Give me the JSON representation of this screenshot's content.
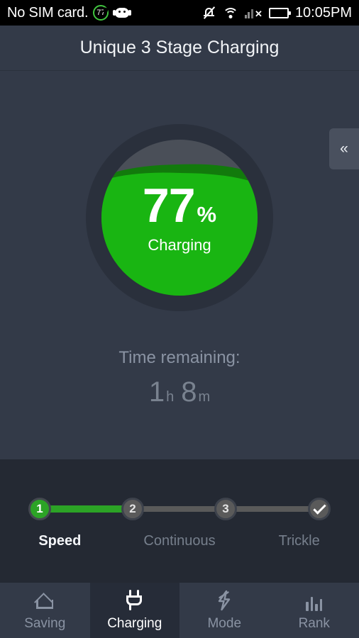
{
  "status_bar": {
    "carrier": "No SIM card.",
    "battery_badge": "77",
    "icons": [
      "battery-circle-icon",
      "android-robot-icon",
      "mute-icon",
      "wifi-icon",
      "signal-no-service-icon",
      "battery-icon"
    ],
    "time": "10:05PM"
  },
  "header": {
    "title": "Unique 3 Stage Charging"
  },
  "main": {
    "collapse_label": "«",
    "gauge": {
      "percent": "77",
      "percent_symbol": "%",
      "state": "Charging",
      "fill_level": 77,
      "fill_color": "#19b512",
      "wave_back_color": "#127a0c",
      "ring_color": "#2a303c",
      "empty_color": "#4a4f58"
    },
    "time_remaining": {
      "label": "Time remaining:",
      "hours": "1",
      "hours_unit": "h",
      "minutes": "8",
      "minutes_unit": "m"
    }
  },
  "stages": {
    "nodes": [
      {
        "label": "1",
        "state": "active"
      },
      {
        "label": "2",
        "state": "pending"
      },
      {
        "label": "3",
        "state": "pending"
      },
      {
        "label": "check",
        "state": "pending"
      }
    ],
    "labels": [
      {
        "text": "Speed",
        "state": "active"
      },
      {
        "text": "Continuous",
        "state": "inactive"
      },
      {
        "text": "Trickle",
        "state": "inactive"
      }
    ],
    "progress_percent": 31,
    "active_color": "#2ca326"
  },
  "navbar": {
    "items": [
      {
        "label": "Saving",
        "icon": "home-icon",
        "active": false
      },
      {
        "label": "Charging",
        "icon": "plug-icon",
        "active": true
      },
      {
        "label": "Mode",
        "icon": "bolt-icon",
        "active": false
      },
      {
        "label": "Rank",
        "icon": "bar-chart-icon",
        "active": false
      }
    ]
  }
}
